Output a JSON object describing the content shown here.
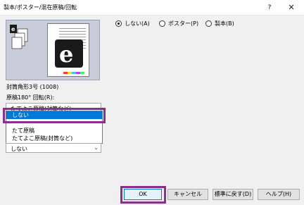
{
  "window": {
    "title": "製本/ポスター/混在原稿/回転",
    "help_label": "?",
    "close_label": "✕"
  },
  "preview": {
    "paper_caption": "封筒角形3号 (1008)"
  },
  "layout_options": [
    {
      "label": "しない(A)",
      "selected": true
    },
    {
      "label": "ポスター(P)",
      "selected": false
    },
    {
      "label": "製本(B)",
      "selected": false
    }
  ],
  "rotation": {
    "label": "原稿180° 回転(R):",
    "combo_value": "たてよこ原稿(封筒など)",
    "dropdown_items": [
      {
        "label": "しない",
        "selected": true
      },
      {
        "label": "",
        "selected": false
      },
      {
        "label": "たて原稿",
        "selected": false
      },
      {
        "label": "たてよこ原稿(封筒など)",
        "selected": false
      }
    ],
    "second_combo_value": "しない"
  },
  "buttons": {
    "ok": "OK",
    "cancel": "キャンセル",
    "reset": "標準に戻す(D)",
    "help": "ヘルプ(H)"
  },
  "colors": {
    "highlight": "#8b2f8e",
    "selection": "#0078d7"
  }
}
